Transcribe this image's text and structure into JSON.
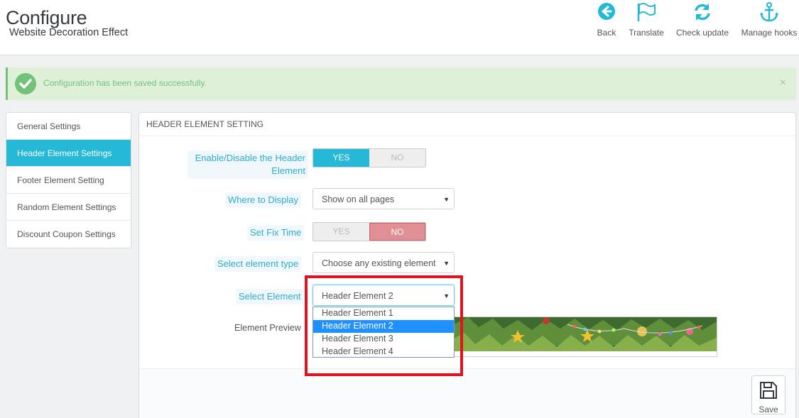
{
  "header": {
    "title": "Configure",
    "subtitle": "Website Decoration Effect",
    "toolbar": [
      {
        "label": "Back",
        "icon": "arrow-left-circle-icon"
      },
      {
        "label": "Translate",
        "icon": "flag-icon"
      },
      {
        "label": "Check update",
        "icon": "refresh-icon"
      },
      {
        "label": "Manage hooks",
        "icon": "anchor-icon"
      }
    ]
  },
  "alert": {
    "message": "Configuration has been saved successfully.",
    "close": "×"
  },
  "sidebar": {
    "items": [
      {
        "label": "General Settings",
        "active": false
      },
      {
        "label": "Header Element Settings",
        "active": true
      },
      {
        "label": "Footer Element Setting",
        "active": false
      },
      {
        "label": "Random Element Settings",
        "active": false
      },
      {
        "label": "Discount Coupon Settings",
        "active": false
      }
    ]
  },
  "panel": {
    "heading": "HEADER ELEMENT SETTING",
    "enable": {
      "label": "Enable/Disable the Header Element",
      "yes": "YES",
      "no": "NO",
      "value": "YES"
    },
    "where": {
      "label": "Where to Display",
      "value": "Show on all pages"
    },
    "fixtime": {
      "label": "Set Fix Time",
      "yes": "YES",
      "no": "NO",
      "value": "NO"
    },
    "type": {
      "label": "Select element type",
      "value": "Choose any existing element"
    },
    "element": {
      "label": "Select Element",
      "value": "Header Element 2",
      "options": [
        "Header Element 1",
        "Header Element 2",
        "Header Element 3",
        "Header Element 4"
      ]
    },
    "preview": {
      "label": "Element Preview"
    },
    "save": "Save"
  },
  "colors": {
    "accent": "#25b9d7",
    "success": "#72c279",
    "no_active": "#e08f95",
    "highlight": "#e0141e"
  }
}
